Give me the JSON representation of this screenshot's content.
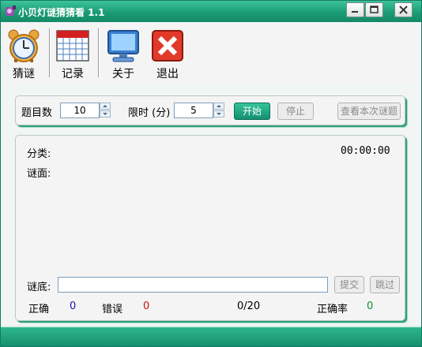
{
  "window": {
    "title": "小贝灯谜猜猜看 1.1"
  },
  "toolbar": {
    "items": [
      {
        "label": "猜谜",
        "icon": "alarm-clock-icon"
      },
      {
        "label": "记录",
        "icon": "calendar-table-icon"
      },
      {
        "label": "关于",
        "icon": "monitor-icon"
      },
      {
        "label": "退出",
        "icon": "red-x-exit-icon"
      }
    ]
  },
  "settings": {
    "count_label": "题目数",
    "count_value": "10",
    "time_label": "限时 (分)",
    "time_value": "5",
    "start_label": "开始",
    "stop_label": "停止",
    "view_label": "查看本次谜题"
  },
  "riddle": {
    "category_label": "分类:",
    "timer": "00:00:00",
    "question_label": "谜面:",
    "answer_label": "谜底:",
    "answer_value": "",
    "submit_label": "提交",
    "skip_label": "跳过"
  },
  "stats": {
    "correct_label": "正确",
    "correct_value": "0",
    "wrong_label": "错误",
    "wrong_value": "0",
    "progress": "0/20",
    "rate_label": "正确率",
    "rate_value": "0"
  },
  "colors": {
    "title_bar": "#1b9c74",
    "correct": "#1a1aa0",
    "wrong": "#d01010",
    "rate": "#128a2a"
  }
}
